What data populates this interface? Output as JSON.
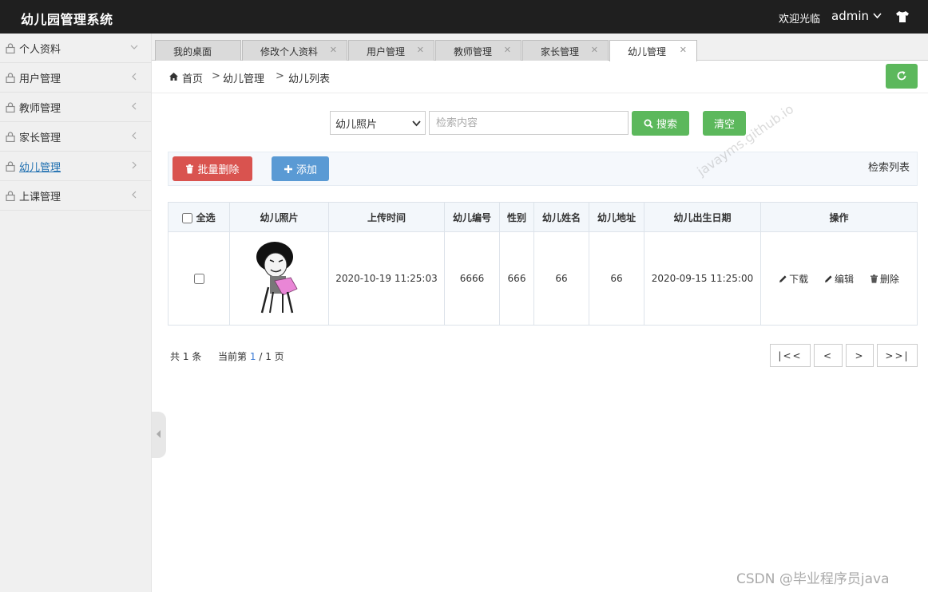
{
  "header": {
    "title": "幼儿园管理系统",
    "welcome": "欢迎光临",
    "username": "admin"
  },
  "sidebar": {
    "items": [
      {
        "label": "个人资料",
        "arrow": "chevron-down"
      },
      {
        "label": "用户管理",
        "arrow": "chevron-left"
      },
      {
        "label": "教师管理",
        "arrow": "chevron-left"
      },
      {
        "label": "家长管理",
        "arrow": "chevron-left"
      },
      {
        "label": "幼儿管理",
        "arrow": "chevron-right",
        "active": true
      },
      {
        "label": "上课管理",
        "arrow": "chevron-left"
      }
    ]
  },
  "tabs": [
    {
      "label": "我的桌面",
      "closable": false
    },
    {
      "label": "修改个人资料",
      "closable": true
    },
    {
      "label": "用户管理",
      "closable": true
    },
    {
      "label": "教师管理",
      "closable": true
    },
    {
      "label": "家长管理",
      "closable": true
    },
    {
      "label": "幼儿管理",
      "closable": true,
      "active": true
    }
  ],
  "breadcrumb": {
    "home": "首页",
    "level1": "幼儿管理",
    "level2": "幼儿列表",
    "separator": ">"
  },
  "search": {
    "field_selected": "幼儿照片",
    "placeholder": "检索内容",
    "search_label": "搜索",
    "clear_label": "清空"
  },
  "toolbar": {
    "batch_delete_label": "批量删除",
    "add_label": "添加",
    "list_title": "检索列表"
  },
  "table": {
    "select_all_label": "全选",
    "columns": [
      "幼儿照片",
      "上传时间",
      "幼儿编号",
      "性别",
      "幼儿姓名",
      "幼儿地址",
      "幼儿出生日期",
      "操作"
    ],
    "rows": [
      {
        "upload_time": "2020-10-19 11:25:03",
        "child_no": "6666",
        "gender": "666",
        "child_name": "66",
        "address": "66",
        "birth_date": "2020-09-15 11:25:00",
        "ops": {
          "download": "下载",
          "edit": "编辑",
          "delete": "删除"
        }
      }
    ]
  },
  "pagination": {
    "total_prefix": "共",
    "total_count": "1",
    "total_suffix": "条",
    "current_prefix": "当前第",
    "current_page": "1",
    "page_sep": "/",
    "page_total": "1",
    "page_suffix": "页",
    "first": "|<<",
    "prev": "<",
    "next": ">",
    "last": ">>|"
  },
  "watermarks": {
    "repo": "javayms.github.io",
    "corner": "CSDN @毕业程序员java"
  },
  "colors": {
    "topbar": "#1f1f1f",
    "success": "#5cb85c",
    "danger": "#d9534f",
    "primary": "#5a9ad4"
  }
}
